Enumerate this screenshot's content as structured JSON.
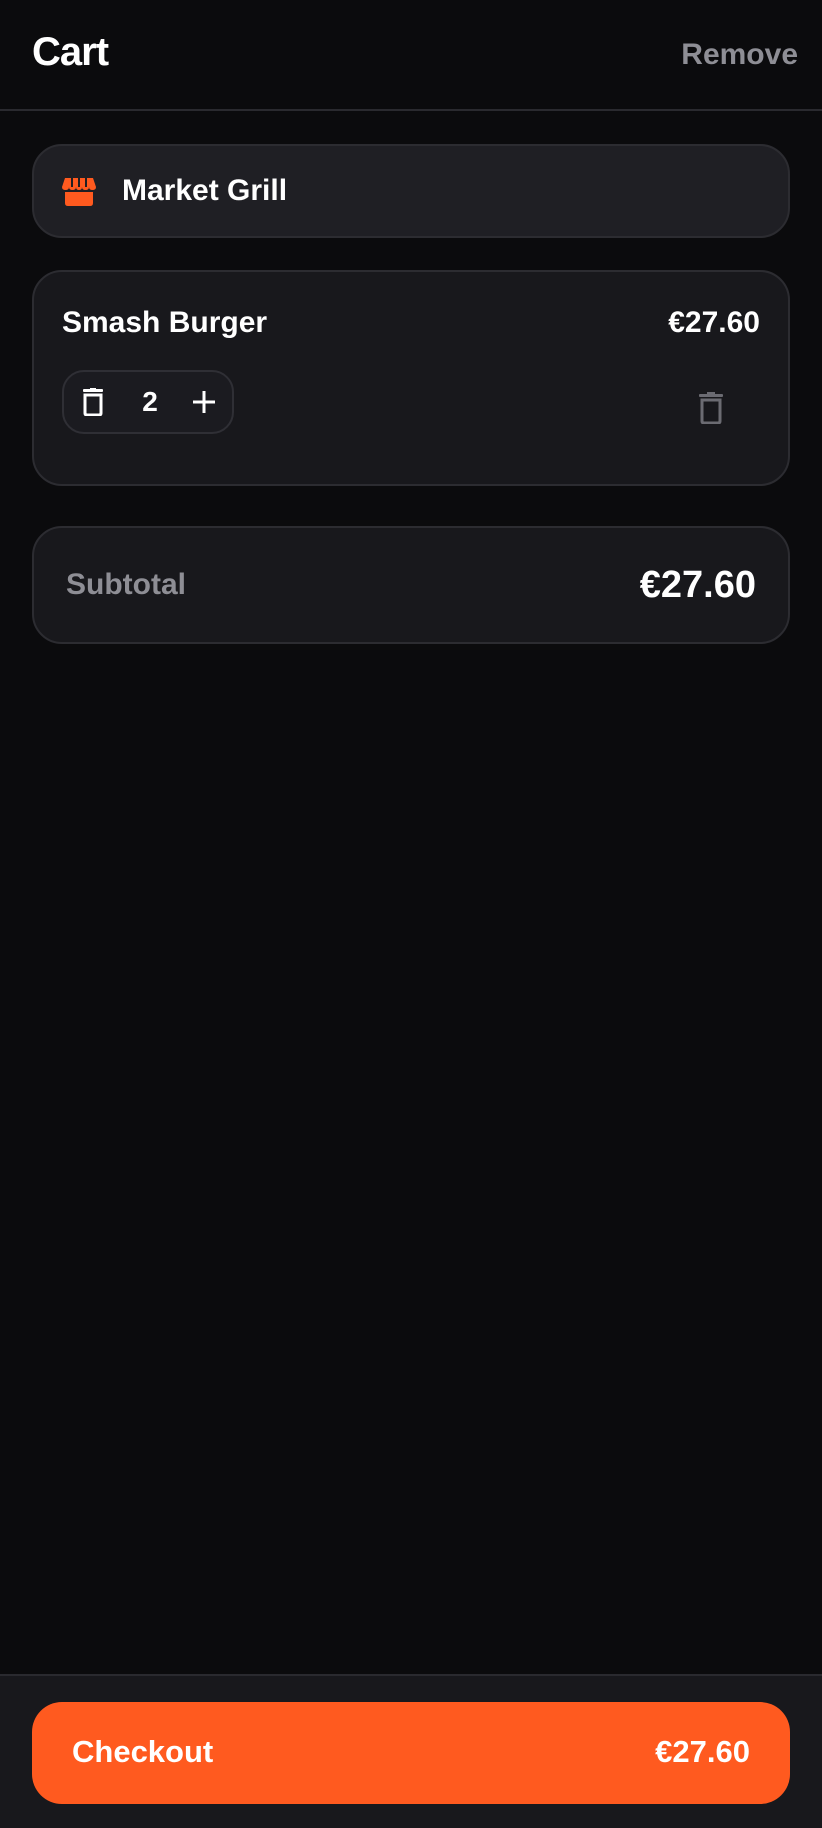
{
  "header": {
    "title": "Cart",
    "remove_label": "Remove"
  },
  "restaurant": {
    "name": "Market Grill",
    "icon": "store-icon"
  },
  "cart_item": {
    "name": "Smash Burger",
    "price": "€27.60",
    "quantity": "2",
    "decrement_icon": "trash-icon",
    "increment_icon": "plus-icon",
    "remove_icon": "trash-icon"
  },
  "summary": {
    "subtotal_label": "Subtotal",
    "subtotal_value": "€27.60"
  },
  "footer": {
    "checkout_label": "Checkout",
    "checkout_amount": "€27.60"
  },
  "colors": {
    "accent": "#ff5a1f",
    "background": "#0b0b0d",
    "card": "#18181c",
    "muted_text": "#8e8e95"
  }
}
